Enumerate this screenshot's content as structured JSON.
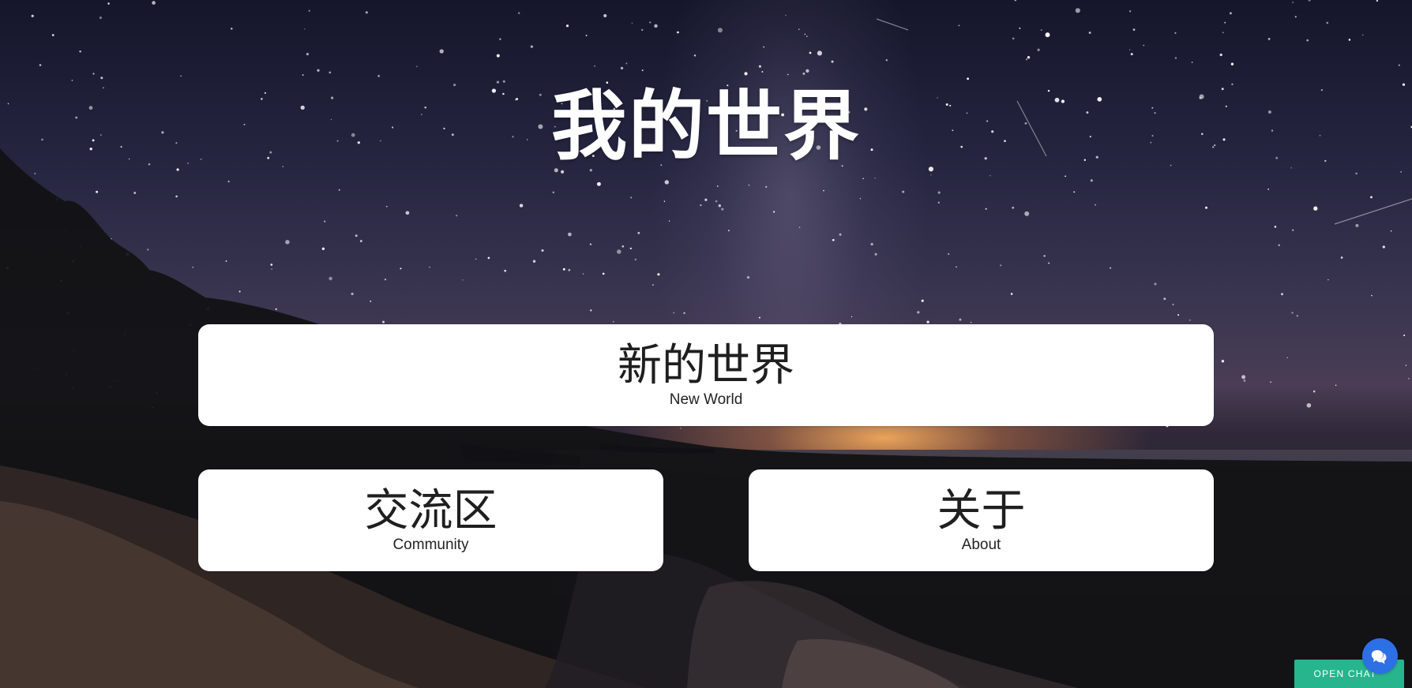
{
  "page": {
    "title": "我的世界"
  },
  "cards": {
    "new_world": {
      "title": "新的世界",
      "subtitle": "New World"
    },
    "community": {
      "title": "交流区",
      "subtitle": "Community"
    },
    "about": {
      "title": "关于",
      "subtitle": "About"
    }
  },
  "chat": {
    "open_label": "OPEN CHAT",
    "icon": "chat-bubble-icon"
  },
  "background": {
    "description_icon": "night-sky-background"
  },
  "colors": {
    "title": "#ffffff",
    "card_background": "#ffffff",
    "card_text": "#1f1f1f",
    "chat_button": "#27b58e",
    "chat_bubble": "#2d6fe5"
  }
}
